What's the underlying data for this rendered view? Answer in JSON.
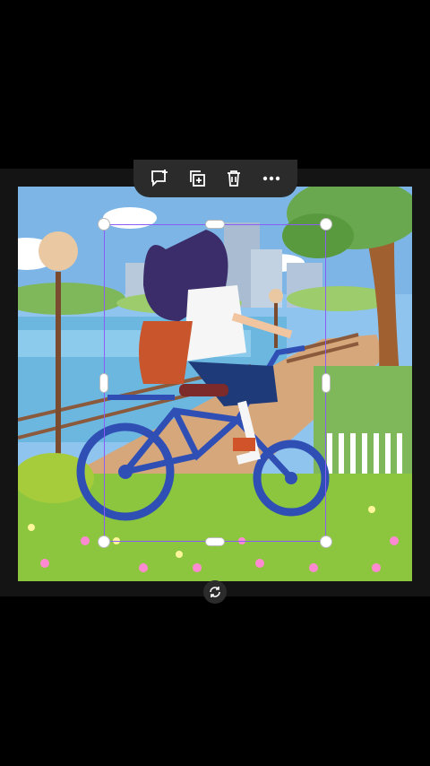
{
  "toolbar": {
    "buttons": [
      {
        "icon": "comment-add-icon"
      },
      {
        "icon": "duplicate-icon"
      },
      {
        "icon": "trash-icon"
      },
      {
        "icon": "more-options-icon"
      }
    ]
  },
  "canvas": {
    "image": {
      "subject": "girl-on-bicycle-illustration",
      "selected": true
    }
  },
  "controls": {
    "rotate_icon": "rotate-icon"
  },
  "colors": {
    "selection": "#8b5cf6",
    "toolbar_bg": "#2b2b2b",
    "sky": "#8fc4ee",
    "grass": "#8cc63f",
    "bicycle": "#2f4fb5"
  }
}
